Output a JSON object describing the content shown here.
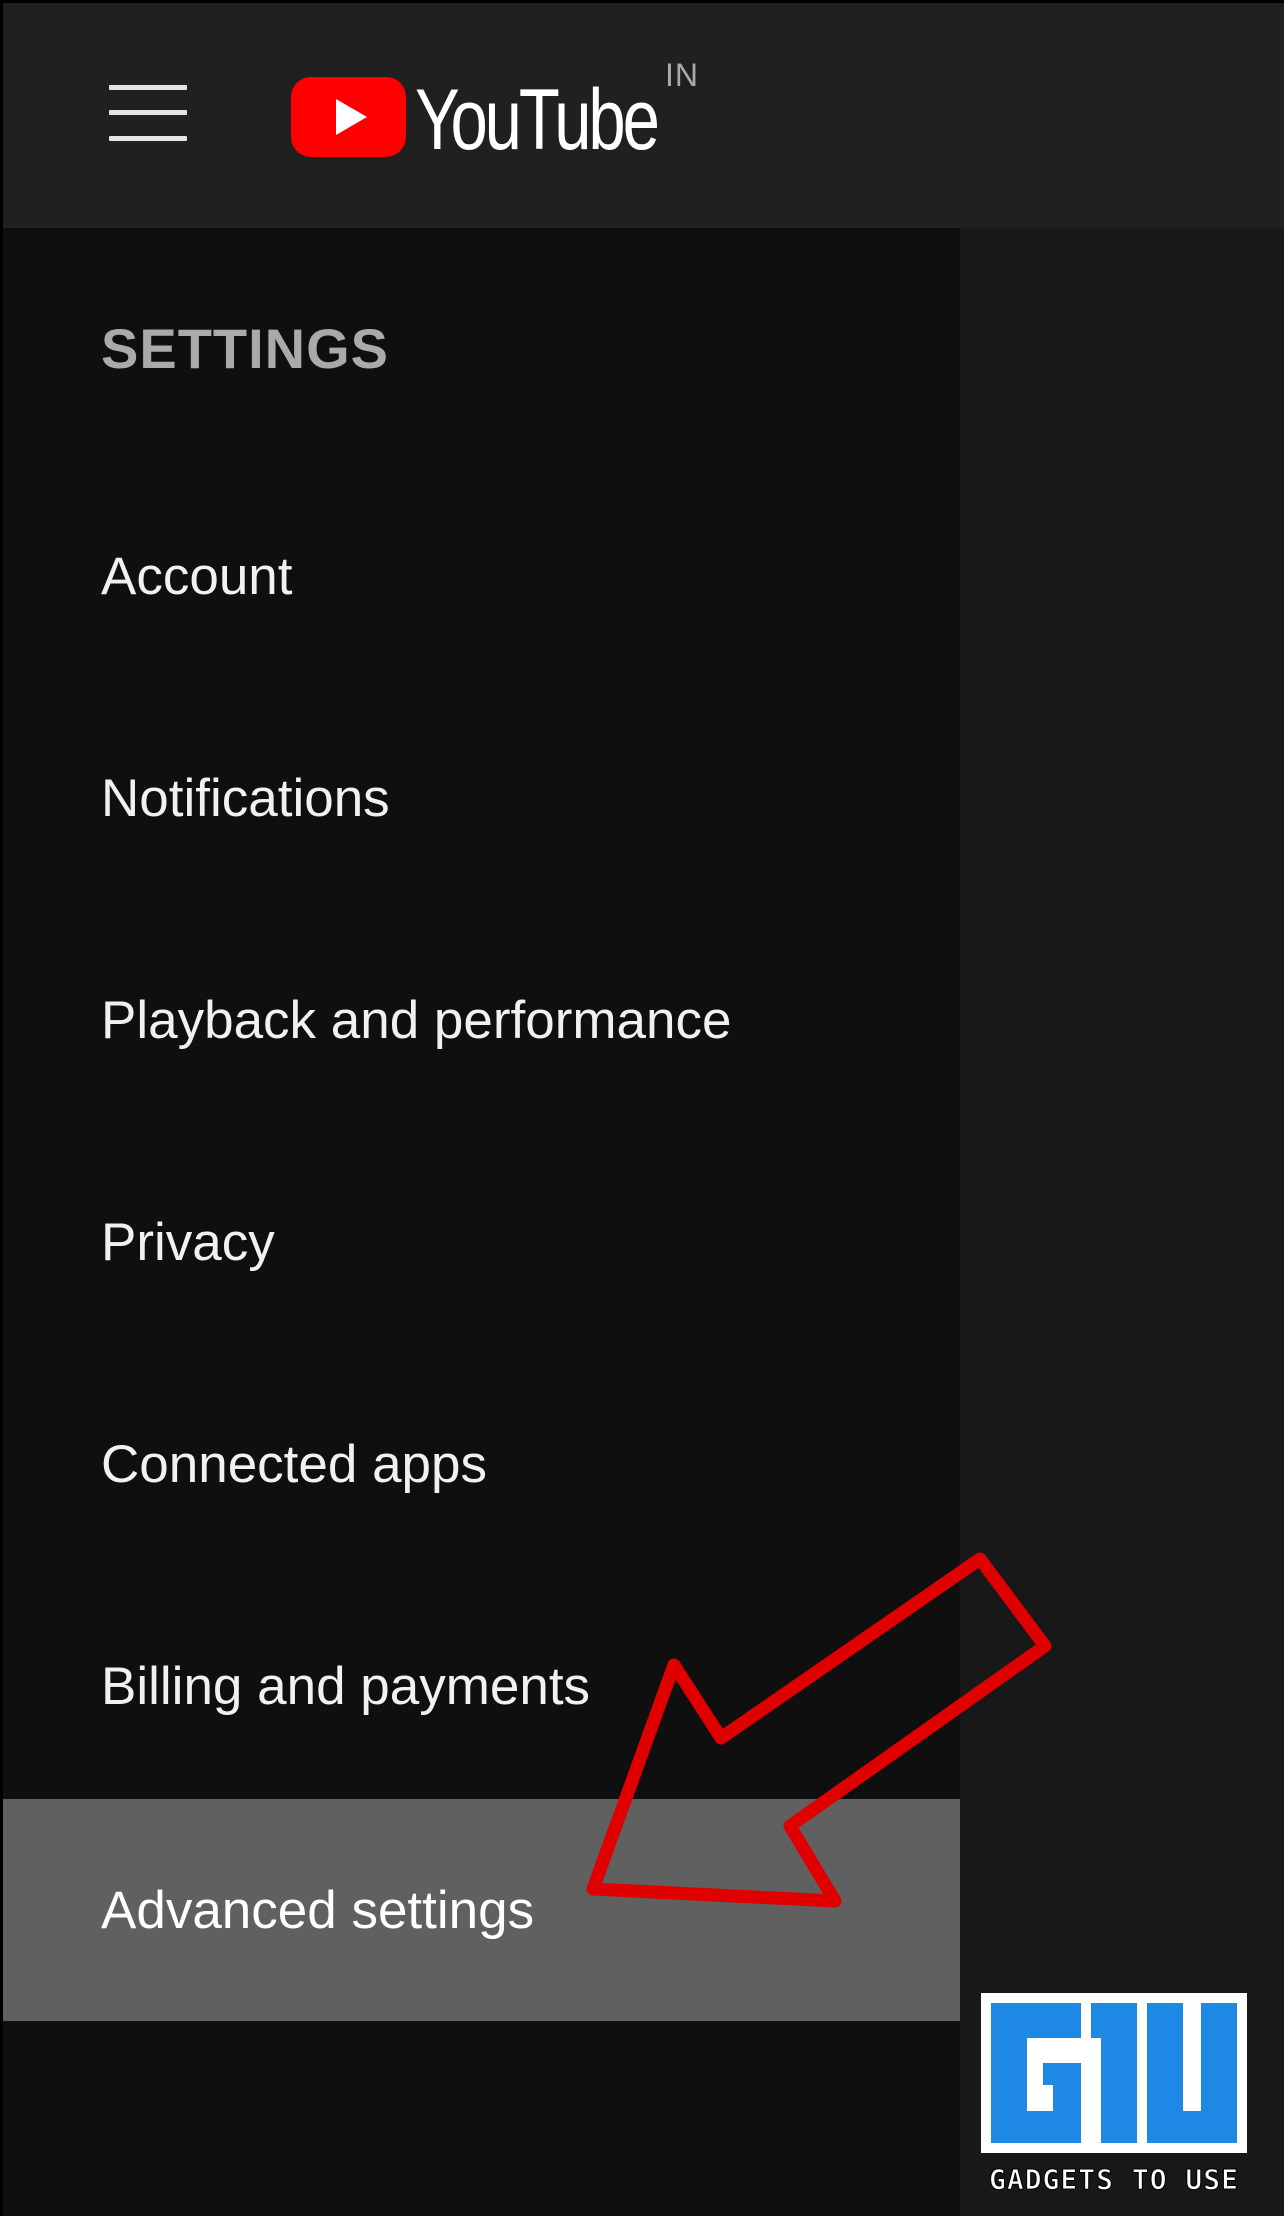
{
  "header": {
    "menu_icon": "hamburger-menu-icon",
    "logo_icon": "youtube-play-icon",
    "logo_text": "YouTube",
    "country_code": "IN"
  },
  "sidebar": {
    "heading": "SETTINGS",
    "items": [
      {
        "label": "Account"
      },
      {
        "label": "Notifications"
      },
      {
        "label": "Playback and performance"
      },
      {
        "label": "Privacy"
      },
      {
        "label": "Connected apps"
      },
      {
        "label": "Billing and payments"
      },
      {
        "label": "Advanced settings",
        "active": true
      }
    ]
  },
  "annotation": {
    "arrow_icon": "red-arrow-annotation",
    "arrow_color": "#e00000"
  },
  "watermark": {
    "logo_icon": "gadgets-to-use-logo",
    "text": "GADGETS TO USE",
    "color": "#1e88e5"
  },
  "colors": {
    "topbar": "#202020",
    "sidebar_bg": "#0f0f0f",
    "active_item_bg": "#606060",
    "logo_red": "#ff0000"
  }
}
